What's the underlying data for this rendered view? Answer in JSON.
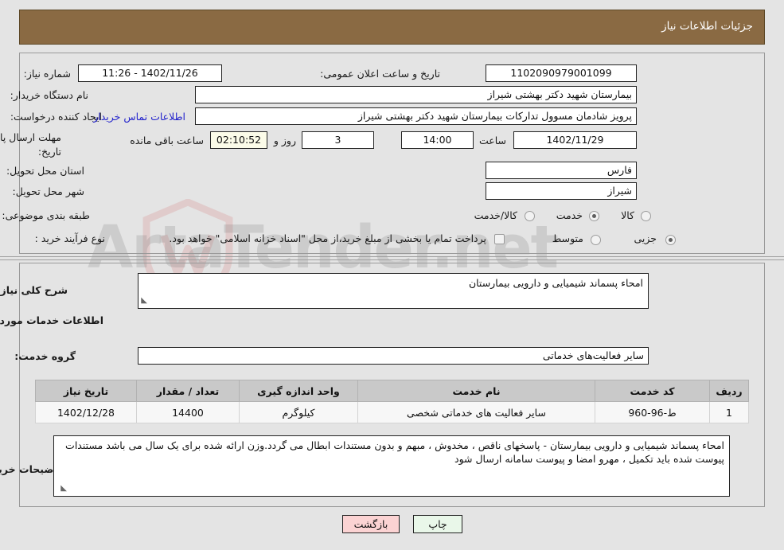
{
  "header": {
    "title": "جزئیات اطلاعات نیاز",
    "bg_color": "#8a6a43"
  },
  "watermark": {
    "text": "ArtaTender.net"
  },
  "top_form": {
    "need_number_label": "شماره نیاز:",
    "need_number_value": "1102090979001099",
    "buyer_org_label": "نام دستگاه خریدار:",
    "buyer_org_value": "بیمارستان شهید دکتر بهشتی شیراز",
    "requester_label": "ایجاد کننده درخواست:",
    "requester_value": "پرویز شادمان مسوول تدارکات بیمارستان شهید دکتر بهشتی شیراز",
    "contact_link": "اطلاعات تماس خریدار",
    "deadline_label_line1": "مهلت ارسال پاسخ: تا",
    "deadline_label_line2": "تاریخ:",
    "deadline_date": "1402/11/29",
    "hour_label": "ساعت",
    "deadline_time": "14:00",
    "days_remaining": "3",
    "days_label": "روز و",
    "countdown": "02:10:52",
    "countdown_suffix": "ساعت باقی مانده",
    "announce_label": "تاریخ و ساعت اعلان عمومی:",
    "announce_value": "1402/11/26 - 11:26",
    "province_label": "استان محل تحویل:",
    "province_value": "فارس",
    "city_label": "شهر محل تحویل:",
    "city_value": "شیراز",
    "category_label": "طبقه بندی موضوعی:",
    "category_options": [
      "کالا",
      "خدمت",
      "کالا/خدمت"
    ],
    "category_selected": "خدمت",
    "process_label": "نوع فرآیند خرید :",
    "process_options": [
      "جزیی",
      "متوسط"
    ],
    "process_selected": "جزیی",
    "treasury_checkbox_checked": false,
    "treasury_text": "پرداخت تمام یا بخشی از مبلغ خرید،از محل \"اسناد خزانه اسلامی\" خواهد بود."
  },
  "middle": {
    "general_desc_label": "شرح کلی نیاز:",
    "general_desc_value": "امحاء پسماند شیمیایی و دارویی بیمارستان",
    "services_heading": "اطلاعات خدمات مورد نیاز",
    "service_group_label": "گروه خدمت:",
    "service_group_value": "سایر فعالیت‌های خدماتی",
    "buyer_notes_label": "توضیحات خریدار:",
    "buyer_notes_value": "امحاء پسماند شیمیایی و دارویی بیمارستان - پاسخهای ناقص ، مخدوش ، مبهم و بدون مستندات ابطال می گردد.وزن ارائه شده برای یک سال می باشد مستندات پیوست شده باید تکمیل ، مهرو امضا و پیوست سامانه ارسال شود"
  },
  "table": {
    "headers": [
      "ردیف",
      "کد خدمت",
      "نام خدمت",
      "واحد اندازه گیری",
      "تعداد / مقدار",
      "تاریخ نیاز"
    ],
    "rows": [
      {
        "row_no": "1",
        "service_code": "ط-96-960",
        "service_name": "سایر فعالیت های خدماتی شخصی",
        "unit": "کیلوگرم",
        "quantity": "14400",
        "need_date": "1402/12/28"
      }
    ]
  },
  "buttons": {
    "print": "چاپ",
    "back": "بازگشت"
  }
}
